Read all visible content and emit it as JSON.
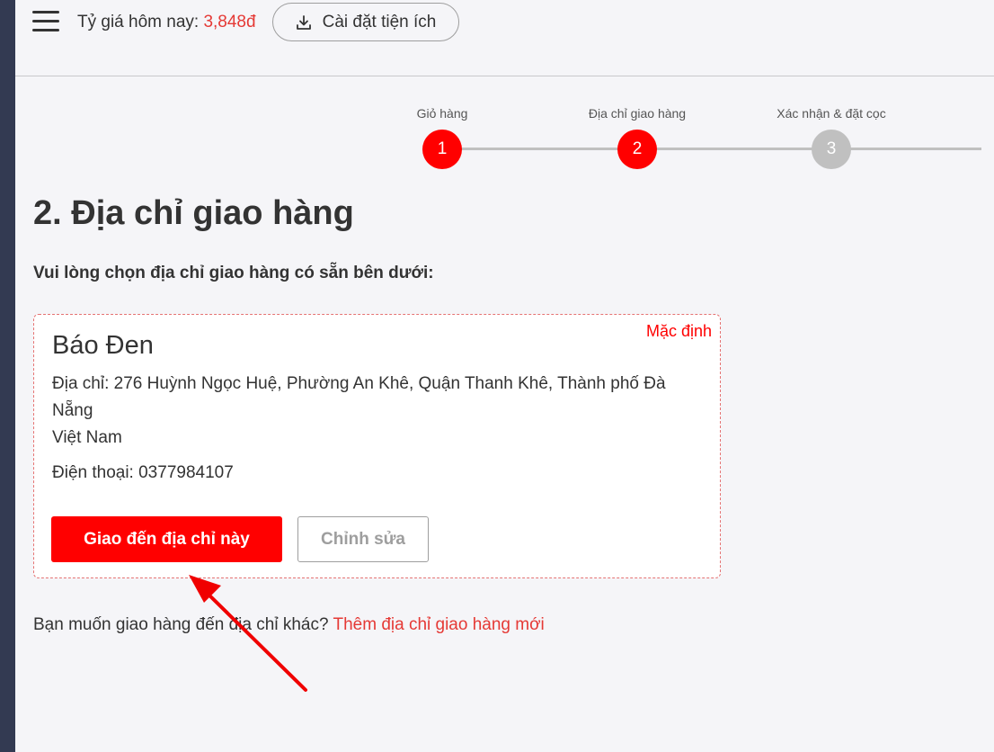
{
  "header": {
    "rate_label": "Tỷ giá hôm nay: ",
    "rate_value": "3,848đ",
    "install_label": "Cài đặt tiện ích",
    "icons": {
      "menu": "hamburger-menu-icon",
      "install": "download-icon"
    }
  },
  "stepper": {
    "steps": [
      {
        "label": "Giỏ hàng",
        "number": "1",
        "state": "active"
      },
      {
        "label": "Địa chỉ giao hàng",
        "number": "2",
        "state": "active"
      },
      {
        "label": "Xác nhận & đặt cọc",
        "number": "3",
        "state": "inactive"
      }
    ]
  },
  "page": {
    "title": "2. Địa chỉ giao hàng",
    "instruction": "Vui lòng chọn địa chỉ giao hàng có sẵn bên dưới:"
  },
  "address_card": {
    "default_badge": "Mặc định",
    "name": "Báo Đen",
    "address_line": "Địa chỉ: 276 Huỳnh Ngọc Huệ, Phường An Khê, Quận Thanh Khê, Thành phố Đà Nẵng",
    "country": "Việt Nam",
    "phone": "Điện thoại: 0377984107",
    "ship_label": "Giao đến địa chỉ này",
    "edit_label": "Chỉnh sửa"
  },
  "footer": {
    "question": "Bạn muốn giao hàng đến địa chỉ khác? ",
    "add_link": "Thêm địa chỉ giao hàng mới"
  },
  "colors": {
    "accent": "#ff0000",
    "link": "#e53935",
    "inactive": "#c0c0c0",
    "sidebar": "#333a52"
  }
}
